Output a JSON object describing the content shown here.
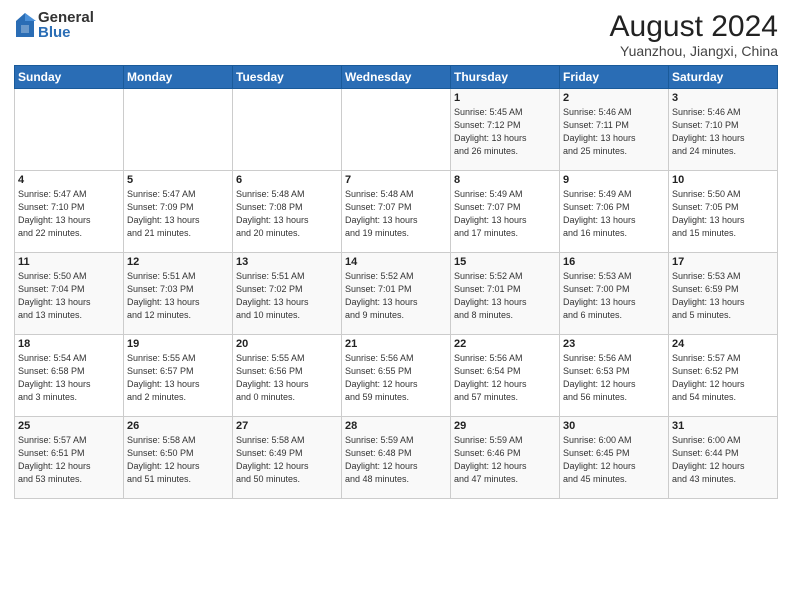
{
  "logo": {
    "general": "General",
    "blue": "Blue"
  },
  "title": "August 2024",
  "subtitle": "Yuanzhou, Jiangxi, China",
  "days_of_week": [
    "Sunday",
    "Monday",
    "Tuesday",
    "Wednesday",
    "Thursday",
    "Friday",
    "Saturday"
  ],
  "weeks": [
    [
      {
        "day": "",
        "info": ""
      },
      {
        "day": "",
        "info": ""
      },
      {
        "day": "",
        "info": ""
      },
      {
        "day": "",
        "info": ""
      },
      {
        "day": "1",
        "info": "Sunrise: 5:45 AM\nSunset: 7:12 PM\nDaylight: 13 hours\nand 26 minutes."
      },
      {
        "day": "2",
        "info": "Sunrise: 5:46 AM\nSunset: 7:11 PM\nDaylight: 13 hours\nand 25 minutes."
      },
      {
        "day": "3",
        "info": "Sunrise: 5:46 AM\nSunset: 7:10 PM\nDaylight: 13 hours\nand 24 minutes."
      }
    ],
    [
      {
        "day": "4",
        "info": "Sunrise: 5:47 AM\nSunset: 7:10 PM\nDaylight: 13 hours\nand 22 minutes."
      },
      {
        "day": "5",
        "info": "Sunrise: 5:47 AM\nSunset: 7:09 PM\nDaylight: 13 hours\nand 21 minutes."
      },
      {
        "day": "6",
        "info": "Sunrise: 5:48 AM\nSunset: 7:08 PM\nDaylight: 13 hours\nand 20 minutes."
      },
      {
        "day": "7",
        "info": "Sunrise: 5:48 AM\nSunset: 7:07 PM\nDaylight: 13 hours\nand 19 minutes."
      },
      {
        "day": "8",
        "info": "Sunrise: 5:49 AM\nSunset: 7:07 PM\nDaylight: 13 hours\nand 17 minutes."
      },
      {
        "day": "9",
        "info": "Sunrise: 5:49 AM\nSunset: 7:06 PM\nDaylight: 13 hours\nand 16 minutes."
      },
      {
        "day": "10",
        "info": "Sunrise: 5:50 AM\nSunset: 7:05 PM\nDaylight: 13 hours\nand 15 minutes."
      }
    ],
    [
      {
        "day": "11",
        "info": "Sunrise: 5:50 AM\nSunset: 7:04 PM\nDaylight: 13 hours\nand 13 minutes."
      },
      {
        "day": "12",
        "info": "Sunrise: 5:51 AM\nSunset: 7:03 PM\nDaylight: 13 hours\nand 12 minutes."
      },
      {
        "day": "13",
        "info": "Sunrise: 5:51 AM\nSunset: 7:02 PM\nDaylight: 13 hours\nand 10 minutes."
      },
      {
        "day": "14",
        "info": "Sunrise: 5:52 AM\nSunset: 7:01 PM\nDaylight: 13 hours\nand 9 minutes."
      },
      {
        "day": "15",
        "info": "Sunrise: 5:52 AM\nSunset: 7:01 PM\nDaylight: 13 hours\nand 8 minutes."
      },
      {
        "day": "16",
        "info": "Sunrise: 5:53 AM\nSunset: 7:00 PM\nDaylight: 13 hours\nand 6 minutes."
      },
      {
        "day": "17",
        "info": "Sunrise: 5:53 AM\nSunset: 6:59 PM\nDaylight: 13 hours\nand 5 minutes."
      }
    ],
    [
      {
        "day": "18",
        "info": "Sunrise: 5:54 AM\nSunset: 6:58 PM\nDaylight: 13 hours\nand 3 minutes."
      },
      {
        "day": "19",
        "info": "Sunrise: 5:55 AM\nSunset: 6:57 PM\nDaylight: 13 hours\nand 2 minutes."
      },
      {
        "day": "20",
        "info": "Sunrise: 5:55 AM\nSunset: 6:56 PM\nDaylight: 13 hours\nand 0 minutes."
      },
      {
        "day": "21",
        "info": "Sunrise: 5:56 AM\nSunset: 6:55 PM\nDaylight: 12 hours\nand 59 minutes."
      },
      {
        "day": "22",
        "info": "Sunrise: 5:56 AM\nSunset: 6:54 PM\nDaylight: 12 hours\nand 57 minutes."
      },
      {
        "day": "23",
        "info": "Sunrise: 5:56 AM\nSunset: 6:53 PM\nDaylight: 12 hours\nand 56 minutes."
      },
      {
        "day": "24",
        "info": "Sunrise: 5:57 AM\nSunset: 6:52 PM\nDaylight: 12 hours\nand 54 minutes."
      }
    ],
    [
      {
        "day": "25",
        "info": "Sunrise: 5:57 AM\nSunset: 6:51 PM\nDaylight: 12 hours\nand 53 minutes."
      },
      {
        "day": "26",
        "info": "Sunrise: 5:58 AM\nSunset: 6:50 PM\nDaylight: 12 hours\nand 51 minutes."
      },
      {
        "day": "27",
        "info": "Sunrise: 5:58 AM\nSunset: 6:49 PM\nDaylight: 12 hours\nand 50 minutes."
      },
      {
        "day": "28",
        "info": "Sunrise: 5:59 AM\nSunset: 6:48 PM\nDaylight: 12 hours\nand 48 minutes."
      },
      {
        "day": "29",
        "info": "Sunrise: 5:59 AM\nSunset: 6:46 PM\nDaylight: 12 hours\nand 47 minutes."
      },
      {
        "day": "30",
        "info": "Sunrise: 6:00 AM\nSunset: 6:45 PM\nDaylight: 12 hours\nand 45 minutes."
      },
      {
        "day": "31",
        "info": "Sunrise: 6:00 AM\nSunset: 6:44 PM\nDaylight: 12 hours\nand 43 minutes."
      }
    ]
  ]
}
